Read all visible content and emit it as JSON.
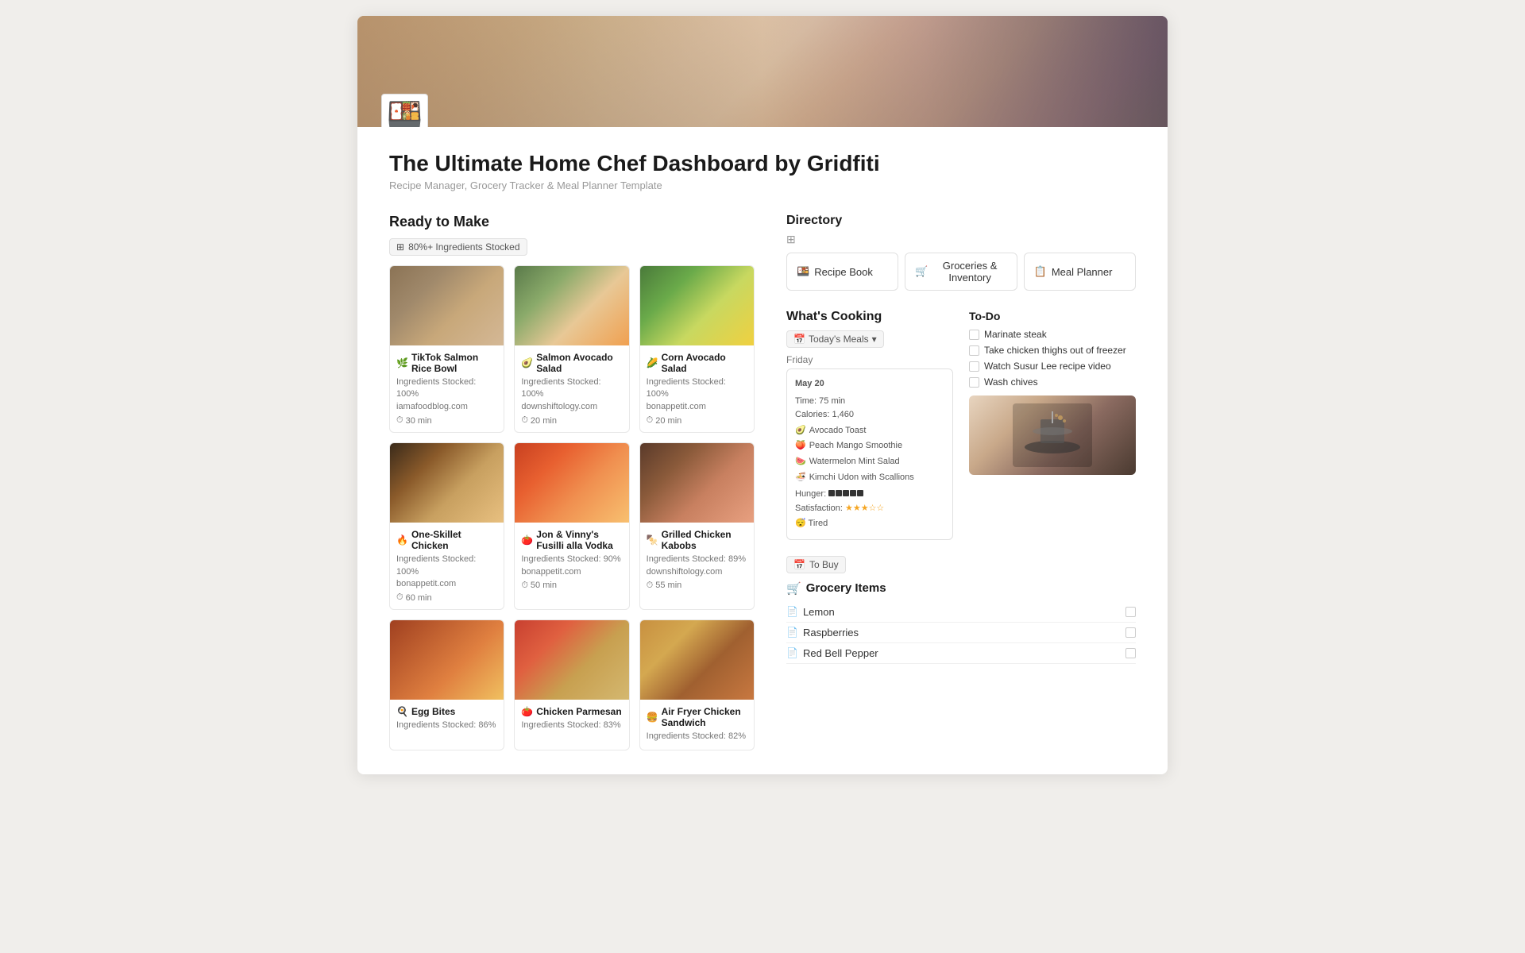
{
  "page": {
    "title": "The Ultimate Home Chef Dashboard by Gridfiti",
    "subtitle": "Recipe Manager, Grocery Tracker & Meal Planner Template",
    "emoji": "🍱"
  },
  "ready_to_make": {
    "section_title": "Ready to Make",
    "badge": "80%+ Ingredients Stocked",
    "recipes": [
      {
        "name": "TikTok Salmon Rice Bowl",
        "emoji": "🌿",
        "stocked": "Ingredients Stocked: 100%",
        "source": "iamafoodblog.com",
        "time": "30 min",
        "img_class": "img-salmon-rice"
      },
      {
        "name": "Salmon Avocado Salad",
        "emoji": "🥑",
        "stocked": "Ingredients Stocked: 100%",
        "source": "downshiftology.com",
        "time": "20 min",
        "img_class": "img-salmon-avocado"
      },
      {
        "name": "Corn Avocado Salad",
        "emoji": "🌽",
        "stocked": "Ingredients Stocked: 100%",
        "source": "bonappetit.com",
        "time": "20 min",
        "img_class": "img-corn-avocado"
      },
      {
        "name": "One-Skillet Chicken",
        "emoji": "🔥",
        "stocked": "Ingredients Stocked: 100%",
        "source": "bonappetit.com",
        "time": "60 min",
        "img_class": "img-chicken"
      },
      {
        "name": "Jon & Vinny's Fusilli alla Vodka",
        "emoji": "🍅",
        "stocked": "Ingredients Stocked: 90%",
        "source": "bonappetit.com",
        "time": "50 min",
        "img_class": "img-fusilli"
      },
      {
        "name": "Grilled Chicken Kabobs",
        "emoji": "🍢",
        "stocked": "Ingredients Stocked: 89%",
        "source": "downshiftology.com",
        "time": "55 min",
        "img_class": "img-kabobs"
      },
      {
        "name": "Egg Bites",
        "emoji": "🍳",
        "stocked": "Ingredients Stocked: 86%",
        "source": "",
        "time": "",
        "img_class": "img-egg-bites"
      },
      {
        "name": "Chicken Parmesan",
        "emoji": "🍅",
        "stocked": "Ingredients Stocked: 83%",
        "source": "",
        "time": "",
        "img_class": "img-chicken-parm"
      },
      {
        "name": "Air Fryer Chicken Sandwich",
        "emoji": "🍔",
        "stocked": "Ingredients Stocked: 82%",
        "source": "",
        "time": "",
        "img_class": "img-sandwich"
      }
    ]
  },
  "directory": {
    "title": "Directory",
    "buttons": [
      {
        "label": "Recipe Book",
        "emoji": "🍱"
      },
      {
        "label": "Groceries & Inventory",
        "emoji": "🛒"
      },
      {
        "label": "Meal Planner",
        "emoji": "📋"
      }
    ]
  },
  "whats_cooking": {
    "title": "What's Cooking",
    "today_meals_label": "Today's Meals",
    "day": "Friday",
    "date": "May 20",
    "time": "Time: 75 min",
    "calories": "Calories: 1,460",
    "meals": [
      {
        "emoji": "🥑",
        "name": "Avocado Toast"
      },
      {
        "emoji": "🍑",
        "name": "Peach Mango Smoothie"
      },
      {
        "emoji": "🍉",
        "name": "Watermelon Mint Salad"
      },
      {
        "emoji": "🍜",
        "name": "Kimchi Udon with Scallions"
      }
    ],
    "hunger_label": "Hunger:",
    "hunger_bars": 5,
    "satisfaction_label": "Satisfaction:",
    "satisfaction_stars": 3,
    "mood": "😴 Tired"
  },
  "todo": {
    "title": "To-Do",
    "items": [
      "Marinate steak",
      "Take chicken thighs out of freezer",
      "Watch Susur Lee recipe video",
      "Wash chives"
    ]
  },
  "to_buy": {
    "badge": "To Buy",
    "title": "Grocery Items",
    "emoji": "🛒",
    "items": [
      "Lemon",
      "Raspberries",
      "Red Bell Pepper"
    ]
  }
}
